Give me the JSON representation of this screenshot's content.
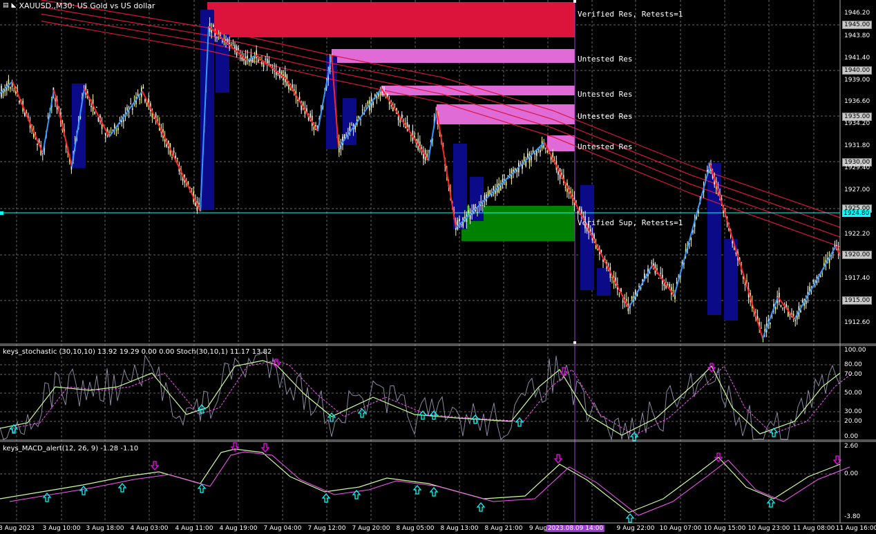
{
  "header": {
    "symbol_line": "XAUUSD.,M30:  US Gold  vs  US dollar"
  },
  "colors": {
    "background": "#000000",
    "bull_candle": "#ffff99",
    "bear_candle": "#ffffff",
    "res_zone_verified": "#dc143c",
    "res_zone_untested": "#e06ad6",
    "sup_zone_verified": "#008000",
    "zigzag_up": "#3399ff",
    "zigzag_down": "#ff2222",
    "ma_lines": "#dc143c",
    "hline_cyan": "#00ffff",
    "vline_violet": "#9a3fd0",
    "stoch_main": "#ccff99",
    "stoch_signal": "#ff55ff",
    "macd_main": "#ccff99",
    "macd_signal": "#ff55ff",
    "arrow_up": "#00ffff",
    "arrow_down": "#ff00ff"
  },
  "zones": [
    {
      "label": "Verified Res, Retests=1",
      "kind": "verified_res"
    },
    {
      "label": "Untested Res",
      "kind": "untested_res"
    },
    {
      "label": "Untested Res",
      "kind": "untested_res"
    },
    {
      "label": "Untested Res",
      "kind": "untested_res"
    },
    {
      "label": "Untested Res",
      "kind": "untested_res"
    },
    {
      "label": "Verified Sup, Retests=1",
      "kind": "verified_sup"
    }
  ],
  "price_axis": {
    "ticks": [
      "1946.20",
      "1943.80",
      "1941.40",
      "1939.00",
      "1936.60",
      "1934.20",
      "1931.80",
      "1929.40",
      "1927.00",
      "1922.20",
      "1917.40",
      "1912.60"
    ],
    "boxed": [
      "1945.00",
      "1940.00",
      "1935.00",
      "1930.00",
      "1925.00",
      "1920.00",
      "1915.00"
    ],
    "current": "1924.80"
  },
  "stochastic": {
    "title": "keys_stochastic (30,10,10) 13.92 19.29 0.00 0.00 Stoch(30,10,1) 11.17 13.82",
    "levels": [
      "100.00",
      "80.00",
      "70.00",
      "50.00",
      "30.00",
      "20.00",
      "0.00"
    ]
  },
  "macd": {
    "title": "keys_MACD_alert(12, 26, 9) -1.28 -1.10",
    "levels": [
      "2.60",
      "0.00",
      "-3.80"
    ]
  },
  "time_axis": {
    "labels": [
      "3 Aug 2023",
      "3 Aug 10:00",
      "3 Aug 18:00",
      "4 Aug 03:00",
      "4 Aug 11:00",
      "4 Aug 19:00",
      "7 Aug 04:00",
      "7 Aug 12:00",
      "7 Aug 20:00",
      "8 Aug 05:00",
      "8 Aug 13:00",
      "8 Aug 21:00",
      "9 Aug",
      "9 Aug 22:00",
      "10 Aug 07:00",
      "10 Aug 15:00",
      "10 Aug 23:00",
      "11 Aug 08:00",
      "11 Aug 16:00"
    ],
    "highlight": "2023.08.09 14:00"
  }
}
